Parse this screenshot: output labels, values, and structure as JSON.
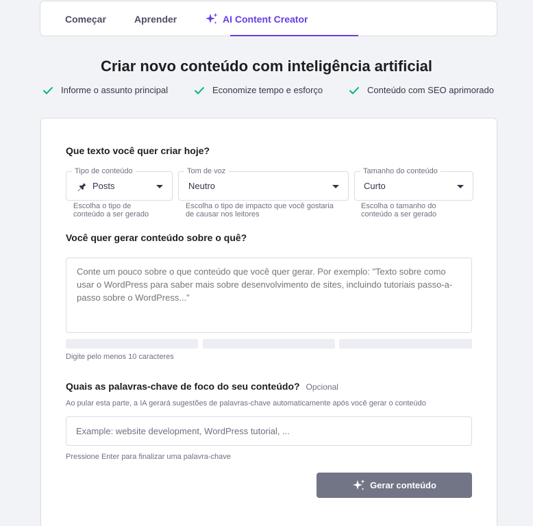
{
  "tabs": [
    {
      "label": "Começar"
    },
    {
      "label": "Aprender"
    },
    {
      "label": "AI Content Creator",
      "icon": "sparkle-icon",
      "active": true
    }
  ],
  "heading": "Criar novo conteúdo com inteligência artificial",
  "benefits": [
    {
      "label": "Informe o assunto principal",
      "icon": "check-icon"
    },
    {
      "label": "Economize tempo e esforço",
      "icon": "check-icon"
    },
    {
      "label": "Conteúdo com SEO aprimorado",
      "icon": "check-icon"
    }
  ],
  "form": {
    "section1_title": "Que texto você quer criar hoje?",
    "selects": [
      {
        "legend": "Tipo de conteúdo",
        "value": "Posts",
        "icon": "pin-icon",
        "helper_line1": "Escolha o tipo de",
        "helper_line2": "conteúdo a ser gerado"
      },
      {
        "legend": "Tom de voz",
        "value": "Neutro",
        "helper_line1": "Escolha o tipo de impacto que você gostaria",
        "helper_line2": "de causar nos leitores"
      },
      {
        "legend": "Tamanho do conteúdo",
        "value": "Curto",
        "helper_line1": "Escolha o tamanho do",
        "helper_line2": "conteúdo a ser gerado"
      }
    ],
    "section2_title": "Você quer gerar conteúdo sobre o quê?",
    "topic_placeholder": "Conte um pouco sobre o que conteúdo que você quer gerar. Por exemplo: \"Texto sobre como usar o WordPress para saber mais sobre desenvolvimento de sites, incluindo tutoriais passo-a-passo sobre o WordPress...\"",
    "topic_helper": "Digite pelo menos 10 caracteres",
    "section3_title": "Quais as palavras-chave de foco do seu conteúdo?",
    "section3_optional": "Opcional",
    "section3_description": "Ao pular esta parte, a IA gerará sugestões de palavras-chave automaticamente após você gerar o conteúdo",
    "keywords_placeholder": "Example: website development, WordPress tutorial, ...",
    "keywords_helper": "Pressione Enter para finalizar uma palavra-chave",
    "generate_label": "Gerar conteúdo"
  },
  "colors": {
    "accent": "#673de6",
    "check": "#00b090",
    "button_disabled": "#727586"
  }
}
